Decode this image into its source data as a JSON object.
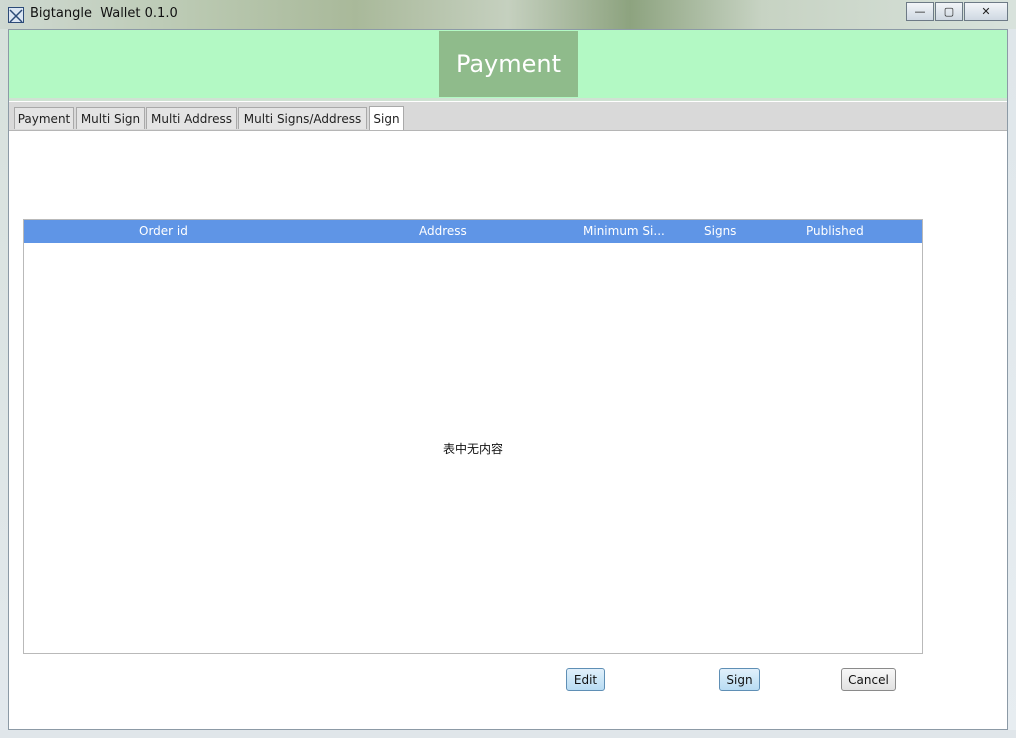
{
  "window": {
    "title": "Bigtangle  Wallet 0.1.0",
    "controls": {
      "minimize": "—",
      "maximize": "▢",
      "close": "✕"
    }
  },
  "header": {
    "title": "Payment"
  },
  "tabs": [
    {
      "label": "Payment",
      "active": false
    },
    {
      "label": "Multi Sign",
      "active": false
    },
    {
      "label": "Multi Address",
      "active": false
    },
    {
      "label": "Multi Signs/Address",
      "active": false
    },
    {
      "label": "Sign",
      "active": true
    }
  ],
  "table": {
    "columns": [
      "Order id",
      "Address",
      "Minimum Si...",
      "Signs",
      "Published"
    ],
    "rows": [],
    "empty_message": "表中无内容"
  },
  "buttons": {
    "edit": "Edit",
    "sign": "Sign",
    "cancel": "Cancel"
  },
  "colors": {
    "header_band": "#b3f9c4",
    "header_title_bg": "#8fbb8b",
    "table_header": "#5f95e6"
  }
}
